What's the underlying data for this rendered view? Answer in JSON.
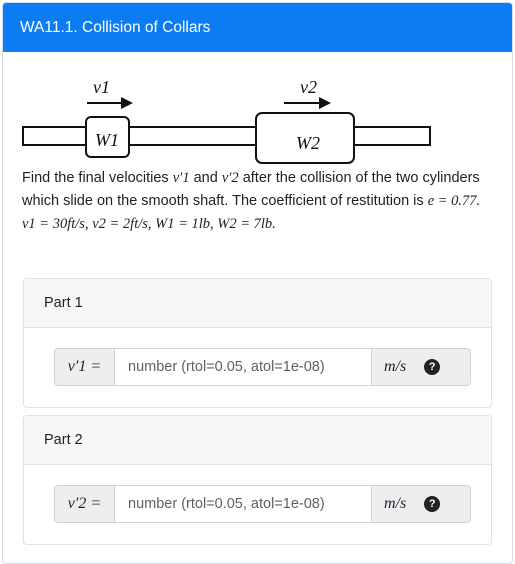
{
  "header": {
    "title": "WA11.1. Collision of Collars"
  },
  "figure": {
    "v1_label": "v1",
    "v2_label": "v2",
    "w1_label": "W1",
    "w2_label": "W2"
  },
  "problem": {
    "text_1": "Find the final velocities ",
    "v1p": "v′1",
    "text_and": " and ",
    "v2p": "v′2",
    "text_2": " after the collision of the two cylinders which slide on the smooth shaft. The coefficient of restitution is ",
    "params": "e = 0.77. v1 = 30ft/s, v2 = 2ft/s, W1 = 1lb, W2 = 7lb."
  },
  "parts": [
    {
      "title": "Part 1",
      "label": "v′1 =",
      "placeholder": "number (rtol=0.05, atol=1e-08)",
      "unit": "m/s",
      "help_icon": "question-circle-icon"
    },
    {
      "title": "Part 2",
      "label": "v′2 =",
      "placeholder": "number (rtol=0.05, atol=1e-08)",
      "unit": "m/s",
      "help_icon": "question-circle-icon"
    }
  ],
  "colors": {
    "header_bg": "#0d7cf2",
    "part_header_bg": "#f6f7f8"
  }
}
